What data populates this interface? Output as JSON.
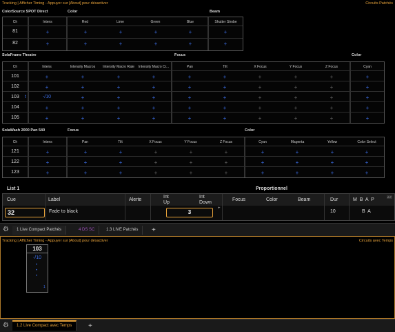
{
  "top_bar": {
    "left": "Tracking | Afficher Timing - Appuyer sur [About] pour désactiver",
    "right": "Circuits Patchés"
  },
  "sections": {
    "colorsource": "ColorSource SPOT Direct",
    "color1": "Color",
    "beam": "Beam",
    "solaframe": "SolaFrame Theatre",
    "focus1": "Focus",
    "color2": "Color",
    "solawash": "SolaWash 2000 Pan 540",
    "focus2": "Focus",
    "color3": "Color"
  },
  "grid1": {
    "headers": [
      "Ch",
      "Intens",
      "Red",
      "Lime",
      "Green",
      "Blue",
      "Shutter Strobe"
    ],
    "rows": [
      "81",
      "82"
    ]
  },
  "grid2": {
    "headers": [
      "Ch",
      "Intens",
      "Intensity Macros",
      "Intensity Macro Rate",
      "Intensity Macro Cr...",
      "Pan",
      "Tilt",
      "X Focus",
      "Y Focus",
      "Z Focus",
      "Cyan"
    ],
    "rows": [
      "101",
      "102",
      "103",
      "104",
      "105"
    ],
    "row103_value": "-/10",
    "row103_marker": "t"
  },
  "grid3": {
    "headers": [
      "Ch",
      "Intens",
      "Pan",
      "Tilt",
      "X Focus",
      "Y Focus",
      "Z Focus",
      "Cyan",
      "Magenta",
      "Yellow",
      "Color Select"
    ],
    "rows": [
      "121",
      "122",
      "123"
    ]
  },
  "list": {
    "title": "List 1",
    "proportionnel": "Proportionnel",
    "headers": {
      "cue": "Cue",
      "label": "Label",
      "alerte": "Alerte",
      "int_up": "Int\nUp",
      "int_down": "Int\nDown",
      "focus": "Focus",
      "color": "Color",
      "beam": "Beam",
      "dur": "Dur",
      "mbap": "M  B  A  P",
      "af": "A F"
    },
    "row": {
      "cue": "32",
      "label": "Fade to black",
      "int_value": "3",
      "dur": "10",
      "flags": "B  A"
    }
  },
  "tabs1": {
    "tab1": "1 Live Compact Patchés",
    "tab2": "4 DS SC",
    "tab3": "1.3 LIVE Patchés",
    "add": "+"
  },
  "bottom_bar": {
    "left": "Tracking | Afficher Timing - Appuyer sur [About] pour désactiver",
    "right": "Circuits avec Temps"
  },
  "tile": {
    "ch": "103",
    "value": "-/10",
    "corner": "1"
  },
  "tabs2": {
    "tab1": "1.2 Live Compact avec Temps",
    "add": "+"
  },
  "colors": {
    "accent": "#e8a33a",
    "plus": "#3c6ee6",
    "tab2": "#a050c0"
  }
}
